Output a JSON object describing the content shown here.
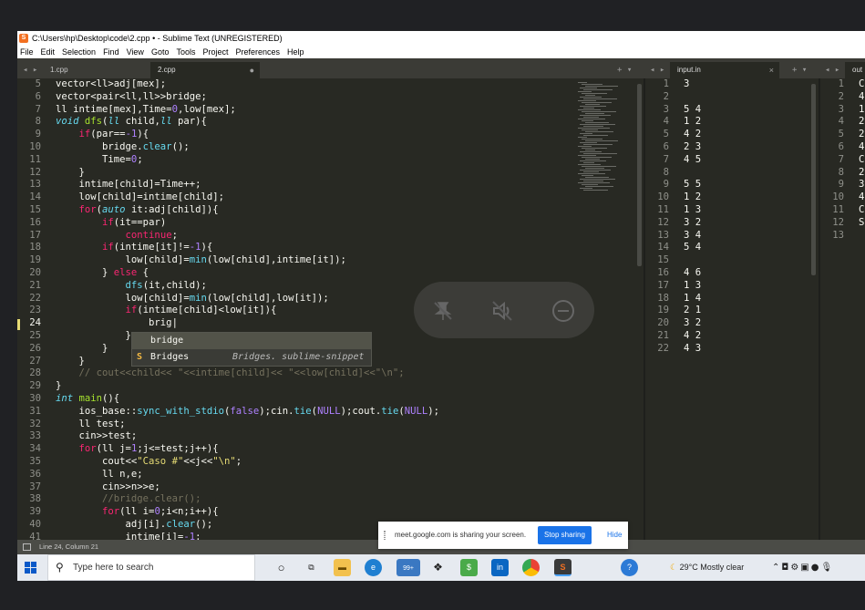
{
  "window": {
    "title": "C:\\Users\\hp\\Desktop\\code\\2.cpp • - Sublime Text (UNREGISTERED)"
  },
  "menu": [
    "File",
    "Edit",
    "Selection",
    "Find",
    "View",
    "Goto",
    "Tools",
    "Project",
    "Preferences",
    "Help"
  ],
  "tabs": [
    {
      "label": "1.cpp"
    },
    {
      "label": "2.cpp",
      "dirty": "●"
    },
    {
      "label": "input.in",
      "close": "×"
    },
    {
      "label": "out"
    }
  ],
  "editor": {
    "line_numbers": [
      "5",
      "6",
      "7",
      "8",
      "9",
      "10",
      "11",
      "12",
      "13",
      "14",
      "15",
      "16",
      "17",
      "18",
      "19",
      "20",
      "21",
      "22",
      "23",
      "24",
      "25",
      "26",
      "27",
      "28",
      "29",
      "30",
      "31",
      "32",
      "33",
      "34",
      "35",
      "36",
      "37",
      "38",
      "39",
      "40",
      "41"
    ],
    "current_line": "24"
  },
  "autocomplete": {
    "items": [
      {
        "label": "bridge",
        "desc": ""
      },
      {
        "label": "Bridges",
        "desc": "Bridges. sublime-snippet",
        "badge": "S"
      }
    ]
  },
  "input_panel": {
    "lines": [
      "1",
      "2",
      "3",
      "4",
      "5",
      "6",
      "7",
      "8",
      "9",
      "10",
      "11",
      "12",
      "13",
      "14",
      "15",
      "16",
      "17",
      "18",
      "19",
      "20",
      "21",
      "22"
    ],
    "content": [
      "3",
      "",
      "5 4",
      "1 2",
      "4 2",
      "2 3",
      "4 5",
      "",
      "5 5",
      "1 2",
      "1 3",
      "3 2",
      "3 4",
      "5 4",
      "",
      "4 6",
      "1 3",
      "1 4",
      "2 1",
      "3 2",
      "4 2",
      "4 3"
    ]
  },
  "output_panel": {
    "lines": [
      "1",
      "2",
      "3",
      "4",
      "5",
      "6",
      "7",
      "8",
      "9",
      "10",
      "11",
      "12",
      "13"
    ],
    "content": [
      "C",
      "4",
      "1",
      "2",
      "2",
      "4",
      "C",
      "2",
      "3",
      "4",
      "C",
      "S",
      ""
    ]
  },
  "status": {
    "position": "Line 24, Column 21"
  },
  "share_banner": {
    "text": "meet.google.com is sharing your screen.",
    "stop_label": "Stop sharing",
    "hide_label": "Hide"
  },
  "taskbar": {
    "search_placeholder": "Type here to search",
    "weather": "29°C  Mostly clear",
    "mail_badge": "99+"
  },
  "colors": {
    "editor_bg": "#282923",
    "keyword": "#f92672",
    "type": "#66d9ef",
    "function": "#a6e22e",
    "number": "#ae81ff",
    "string": "#e6db74",
    "comment": "#75715e",
    "share_button": "#1a73e8"
  }
}
